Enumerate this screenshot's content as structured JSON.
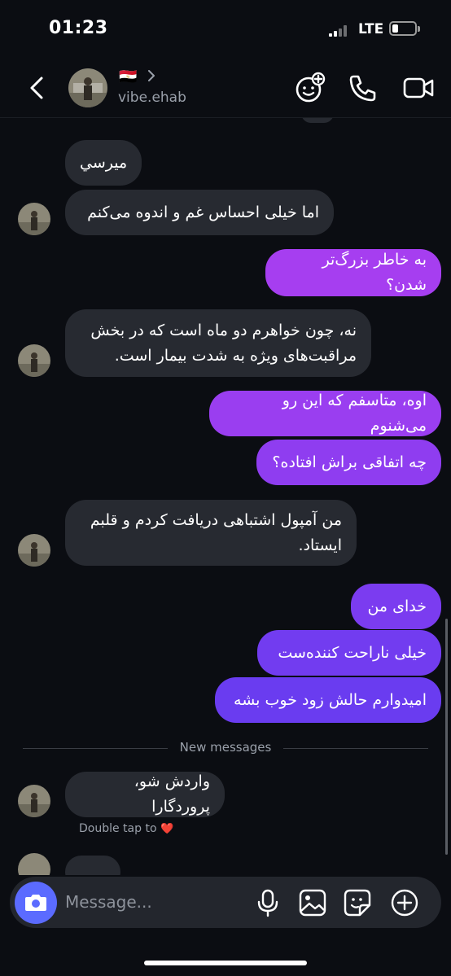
{
  "status_bar": {
    "time": "01:23",
    "network": "LTE"
  },
  "header": {
    "flag": "🇪🇬",
    "username": "vibe.ehab"
  },
  "messages": [
    {
      "side": "in",
      "text": "ميرسي"
    },
    {
      "side": "in",
      "text": "اما خیلی احساس غم و اندوه می‌کنم"
    },
    {
      "side": "out",
      "text": "به خاطر بزرگ‌تر شدن؟"
    },
    {
      "side": "in",
      "text": "نه، چون خواهرم دو ماه است که در بخش مراقبت‌های ویژه به شدت بیمار است."
    },
    {
      "side": "out",
      "text": "اوه، متاسفم که این رو می‌شنوم"
    },
    {
      "side": "out",
      "text": "چه اتفاقی براش افتاده؟"
    },
    {
      "side": "in",
      "text": "من آمپول اشتباهی دریافت کردم و قلبم ایستاد."
    },
    {
      "side": "out",
      "text": "خدای من"
    },
    {
      "side": "out",
      "text": "خیلی ناراحت کننده‌ست"
    },
    {
      "side": "out",
      "text": "امیدوارم حالش زود خوب بشه"
    },
    {
      "side": "in",
      "text": "واردش شو، پروردگارا"
    }
  ],
  "new_messages_label": "New messages",
  "double_tap_hint": "Double tap to",
  "double_tap_emoji": "❤️",
  "composer": {
    "placeholder": "Message..."
  },
  "colors": {
    "background": "#0b0d12",
    "incoming_bubble": "#272a31",
    "outgoing_top": "#a63ef0",
    "outgoing_bottom": "#6a3cf0",
    "camera_button": "#5b6bff"
  },
  "icons": [
    "back-icon",
    "chevron-right-icon",
    "effects-icon",
    "phone-icon",
    "video-icon",
    "camera-icon",
    "microphone-icon",
    "gallery-icon",
    "sticker-icon",
    "plus-icon"
  ]
}
